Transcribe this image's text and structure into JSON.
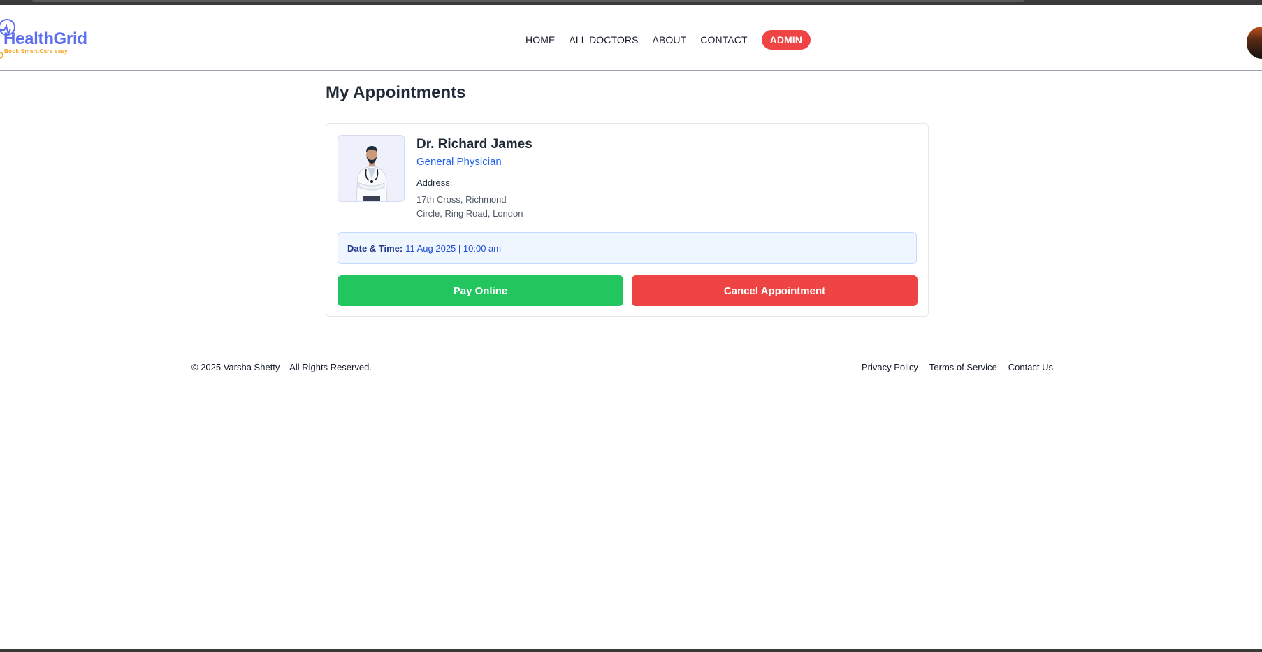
{
  "logo": {
    "name": "HealthGrid",
    "tagline": "Book Smart.Care easy."
  },
  "nav": {
    "items": [
      "HOME",
      "ALL DOCTORS",
      "ABOUT",
      "CONTACT"
    ],
    "admin_label": "ADMIN"
  },
  "page": {
    "title": "My Appointments"
  },
  "appointment": {
    "doctor_name": "Dr. Richard James",
    "speciality": "General Physician",
    "address_label": "Address:",
    "address_line1": "17th Cross, Richmond",
    "address_line2": "Circle, Ring Road, London",
    "datetime_label": "Date & Time:",
    "datetime_value": "11 Aug 2025 | 10:00 am",
    "pay_label": "Pay Online",
    "cancel_label": "Cancel Appointment"
  },
  "footer": {
    "copyright": "© 2025 Varsha Shetty – All Rights Reserved.",
    "links": [
      "Privacy Policy",
      "Terms of Service",
      "Contact Us"
    ]
  },
  "colors": {
    "brand": "#5b6df0",
    "tagline": "#f5a524",
    "admin": "#ef4444",
    "pay": "#22c55e",
    "cancel": "#ef4444",
    "speciality": "#2563eb"
  }
}
